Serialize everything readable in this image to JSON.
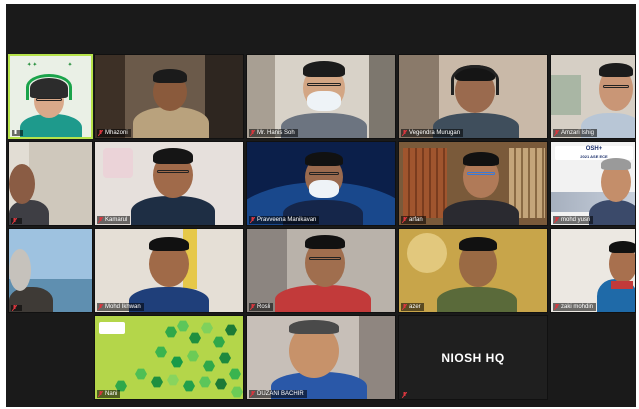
{
  "meeting": {
    "host_label": "NIOSH HQ",
    "participants": [
      {
        "id": "p1",
        "label": ""
      },
      {
        "id": "p2",
        "label": "Mhazoni"
      },
      {
        "id": "p3",
        "label": "Mr. Hanis Soh"
      },
      {
        "id": "p4",
        "label": "Vegendra Murugan"
      },
      {
        "id": "p5",
        "label": "Amzari Ishig"
      },
      {
        "id": "p6",
        "label": ""
      },
      {
        "id": "p7",
        "label": "Kamarul"
      },
      {
        "id": "p8",
        "label": "Pravveena Manikavan"
      },
      {
        "id": "p9",
        "label": "arfan"
      },
      {
        "id": "p10",
        "label": "mohd yusri"
      },
      {
        "id": "p11",
        "label": ""
      },
      {
        "id": "p12",
        "label": "Mohd Ikhwan"
      },
      {
        "id": "p13",
        "label": "Rosli"
      },
      {
        "id": "p14",
        "label": "azer"
      },
      {
        "id": "p15",
        "label": "zaki mohdin"
      },
      {
        "id": "p16",
        "label": "Nani"
      },
      {
        "id": "p17",
        "label": "DUZANI BACHIR"
      },
      {
        "id": "p18",
        "label": ""
      }
    ],
    "banner_text": "OSH+",
    "banner_sub": "2021 ASE ECE"
  },
  "colors": {
    "active_border": "#b6e34a",
    "muted_mic": "#d9363e",
    "tile_bg": "#2b2b2b"
  }
}
